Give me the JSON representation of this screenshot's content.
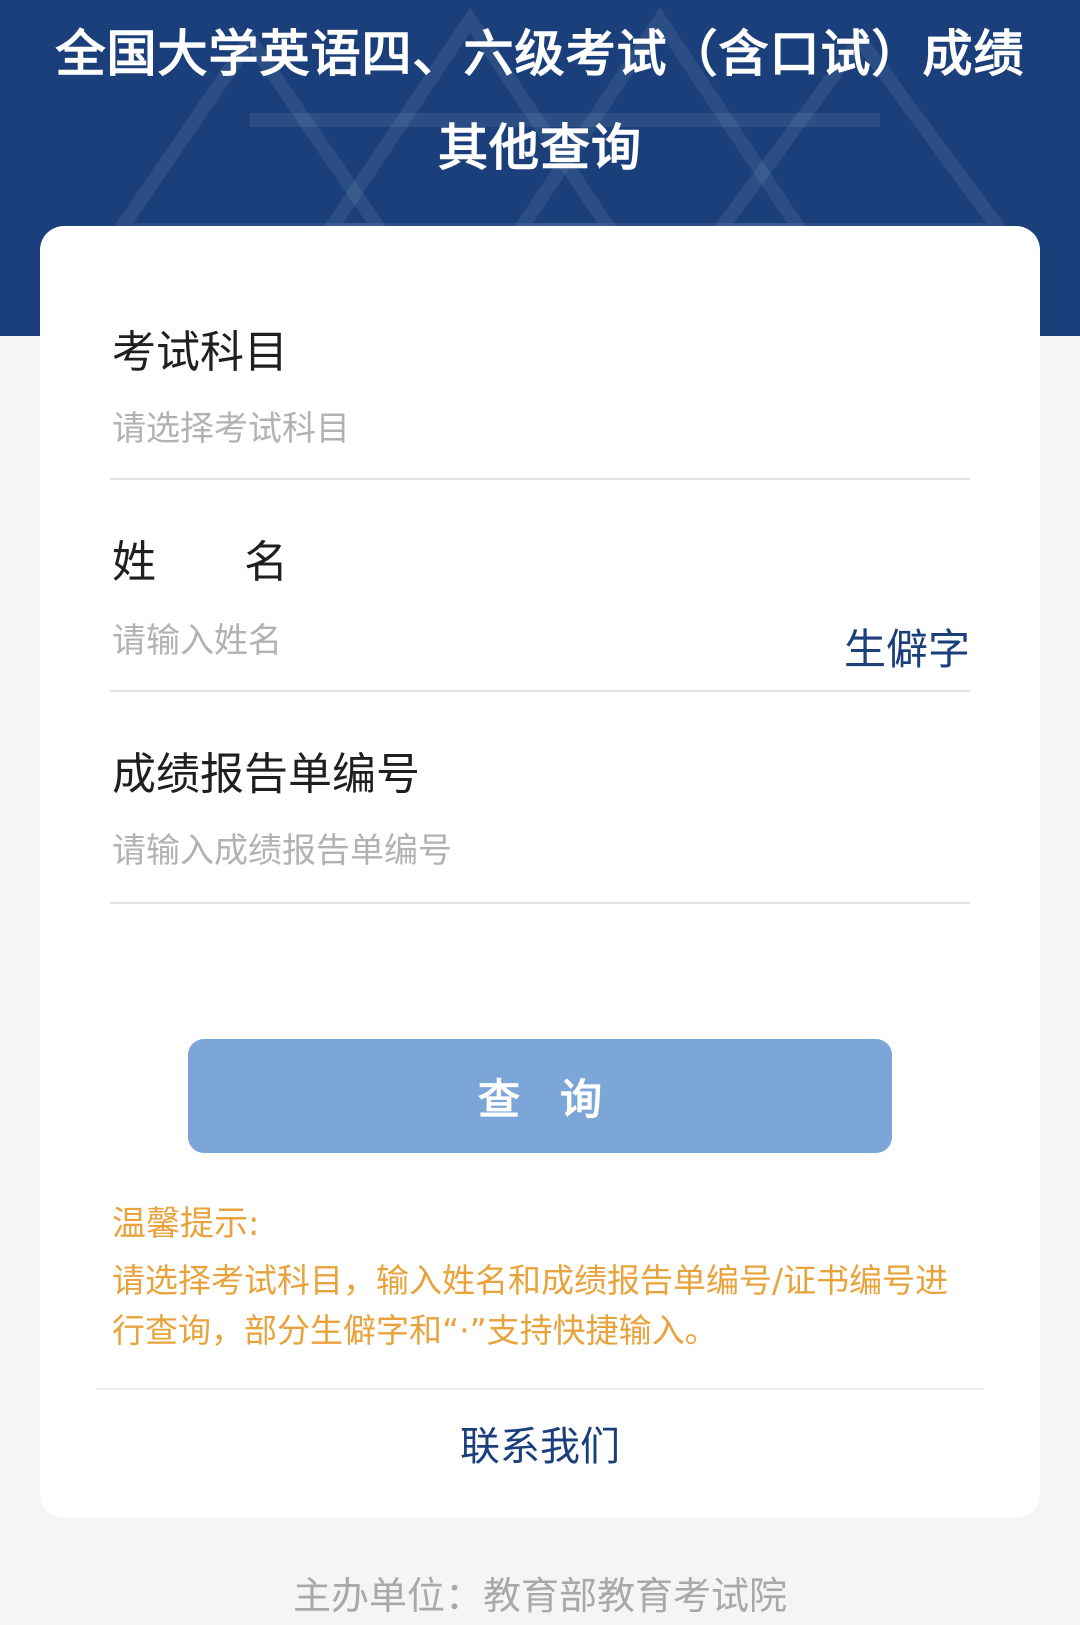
{
  "header": {
    "title_line1": "全国大学英语四、六级考试（含口试）成绩",
    "title_line2": "其他查询"
  },
  "form": {
    "subject": {
      "label": "考试科目",
      "placeholder": "请选择考试科目"
    },
    "name": {
      "label": "姓　　名",
      "placeholder": "请输入姓名",
      "rare_char_link": "生僻字"
    },
    "report_no": {
      "label": "成绩报告单编号",
      "placeholder": "请输入成绩报告单编号"
    },
    "submit_label": "查询"
  },
  "tips": {
    "title": "温馨提示:",
    "body": "请选择考试科目，输入姓名和成绩报告单编号/证书编号进行查询，部分生僻字和“·”支持快捷输入。"
  },
  "contact_label": "联系我们",
  "footer": "主办单位：教育部教育考试院",
  "colors": {
    "header_bg": "#1a3f7a",
    "button_bg": "#7da6d8",
    "tip_color": "#e8a33d",
    "link_color": "#1a3f7a"
  }
}
